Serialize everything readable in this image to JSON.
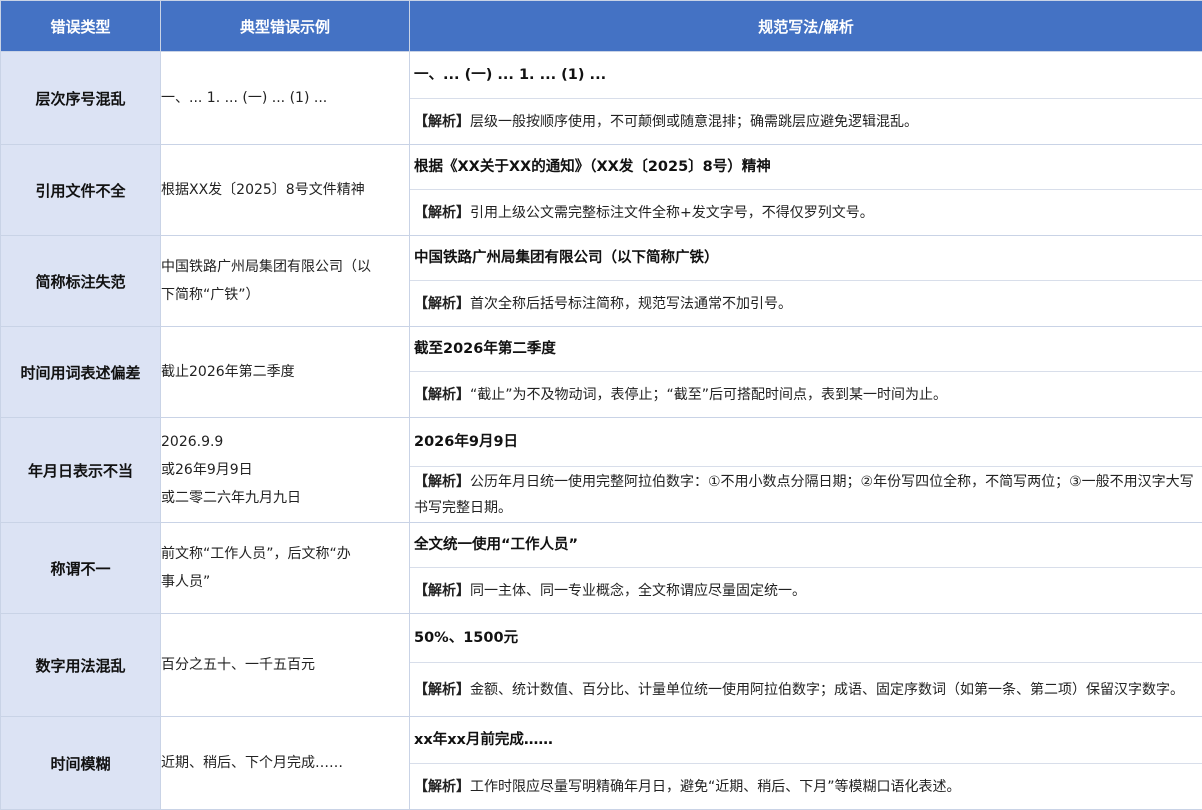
{
  "header": {
    "col1": "错误类型",
    "col2": "典型错误示例",
    "col3": "规范写法/解析"
  },
  "analysis_tag": "【解析】",
  "rows": [
    {
      "type": "层次序号混乱",
      "example": [
        "一、... 1. ... (一) ... (1) ..."
      ],
      "correct": "一、... (一) ... 1. ... (1) ...",
      "analysis": "层级一般按顺序使用，不可颠倒或随意混排；确需跳层应避免逻辑混乱。"
    },
    {
      "type": "引用文件不全",
      "example": [
        "根据XX发〔2025〕8号文件精神"
      ],
      "correct": "根据《XX关于XX的通知》（XX发〔2025〕8号）精神",
      "analysis": "引用上级公文需完整标注文件全称+发文字号，不得仅罗列文号。"
    },
    {
      "type": "简称标注失范",
      "example": [
        "中国铁路广州局集团有限公司（以",
        "下简称“广铁”）"
      ],
      "correct": "中国铁路广州局集团有限公司（以下简称广铁）",
      "analysis": "首次全称后括号标注简称，规范写法通常不加引号。"
    },
    {
      "type": "时间用词表述偏差",
      "example": [
        "截止2026年第二季度"
      ],
      "correct": "截至2026年第二季度",
      "analysis": "“截止”为不及物动词，表停止；“截至”后可搭配时间点，表到某一时间为止。"
    },
    {
      "type": "年月日表示不当",
      "example": [
        "2026.9.9",
        "或26年9月9日",
        "或二零二六年九月九日"
      ],
      "correct": "2026年9月9日",
      "analysis": "公历年月日统一使用完整阿拉伯数字：①不用小数点分隔日期；②年份写四位全称，不简写两位；③一般不用汉字大写书写完整日期。"
    },
    {
      "type": "称谓不一",
      "example": [
        "前文称“工作人员”，后文称“办",
        "事人员”"
      ],
      "correct": "全文统一使用“工作人员”",
      "analysis": "同一主体、同一专业概念，全文称谓应尽量固定统一。"
    },
    {
      "type": "数字用法混乱",
      "example": [
        "百分之五十、一千五百元"
      ],
      "correct": "50%、1500元",
      "analysis": "金额、统计数值、百分比、计量单位统一使用阿拉伯数字；成语、固定序数词（如第一条、第二项）保留汉字数字。"
    },
    {
      "type": "时间模糊",
      "example": [
        "近期、稍后、下个月完成……"
      ],
      "correct": "xx年xx月前完成……",
      "analysis": "工作时限应尽量写明精确年月日，避免“近期、稍后、下月”等模糊口语化表述。"
    }
  ]
}
